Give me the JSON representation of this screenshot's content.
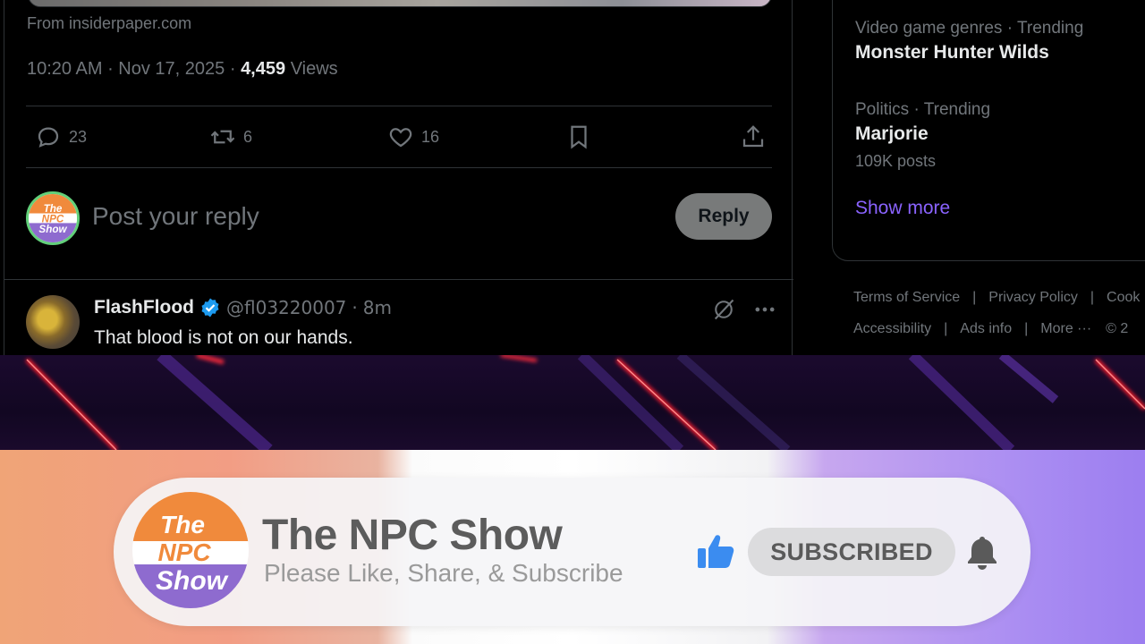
{
  "tweet": {
    "source": "From insiderpaper.com",
    "time": "10:20 AM",
    "date": "Nov 17, 2025",
    "views_count": "4,459",
    "views_label": "Views",
    "replies": "23",
    "reposts": "6",
    "likes": "16"
  },
  "reply_box": {
    "placeholder": "Post your reply",
    "button": "Reply",
    "avatar_text": [
      "The",
      "NPC",
      "Show"
    ]
  },
  "reply_post": {
    "name": "FlashFlood",
    "handle": "@fl03220007",
    "time": "8m",
    "text": "That blood is not on our hands."
  },
  "trends": [
    {
      "category": "Video game genres · Trending",
      "name": "Monster Hunter Wilds",
      "count": ""
    },
    {
      "category": "Politics · Trending",
      "name": "Marjorie",
      "count": "109K posts"
    }
  ],
  "show_more": "Show more",
  "footer": {
    "row1": [
      "Terms of Service",
      "Privacy Policy",
      "Cook"
    ],
    "row2": [
      "Accessibility",
      "Ads info",
      "More ···",
      "© 2"
    ]
  },
  "overlay": {
    "channel_name": "The NPC Show",
    "tagline": "Please Like, Share, & Subscribe",
    "subscribe_button": "SUBSCRIBED",
    "logo_text": [
      "The",
      "NPC",
      "Show"
    ]
  },
  "colors": {
    "accent_link": "#8a63ff",
    "verified": "#1d9bf0",
    "thumb": "#3b8cf0",
    "logo_orange": "#f08a3c",
    "logo_purple": "#8e6bcf"
  }
}
